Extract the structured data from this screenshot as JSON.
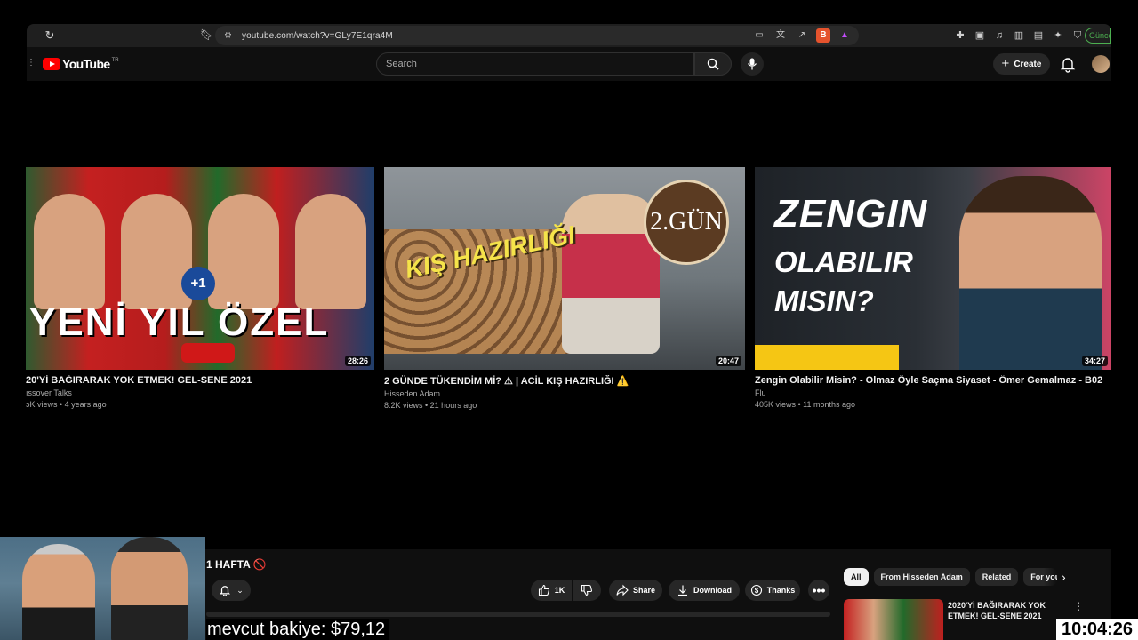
{
  "browser": {
    "url": "youtube.com/watch?v=GLy7E1qra4M",
    "update_label": "Güncelle"
  },
  "header": {
    "logo_text": "YouTube",
    "country_code": "TR",
    "search_placeholder": "Search",
    "create_label": "Create"
  },
  "end_screen": {
    "videos": [
      {
        "title": "20'Yİ BAĞIRARAK YOK ETMEK! GEL-SENE 2021",
        "channel": "ıssover Talks",
        "meta": "ɔK views • 4 years ago",
        "duration": "28:26",
        "thumb_text": "YENİ YIL ÖZEL",
        "thumb_badge": "+1"
      },
      {
        "title": "2 GÜNDE TÜKENDİM Mİ? ⚠ | ACİL KIŞ HAZIRLIĞI ⚠️",
        "channel": "Hisseden Adam",
        "meta": "8.2K views • 21 hours ago",
        "duration": "20:47",
        "thumb_text": "KIŞ HAZIRLIĞI",
        "thumb_badge": "2.GÜN"
      },
      {
        "title": "Zengin Olabilir Misin? - Olmaz Öyle Saçma Siyaset - Ömer Gemalmaz - B02",
        "channel": "Flu",
        "meta": "405K views • 11 months ago",
        "duration": "34:27",
        "thumb_line1": "ZENGIN",
        "thumb_line2": "OLABILIR",
        "thumb_line3": "MISIN?"
      }
    ]
  },
  "watch": {
    "title": "1 HAFTA 🚫",
    "like_count": "1K",
    "share_label": "Share",
    "download_label": "Download",
    "thanks_label": "Thanks",
    "more_label": "•••"
  },
  "sidebar": {
    "chips": [
      "All",
      "From Hisseden Adam",
      "Related",
      "For you"
    ],
    "related_title": "2020'Yİ BAĞIRARAK YOK ETMEK! GEL-SENE 2021"
  },
  "overlay": {
    "balance_text": "mevcut bakiye: $79,12",
    "clock": "10:04:26"
  },
  "colors": {
    "brand_red": "#ff0000",
    "background": "#0f0f0f",
    "chip_bg": "#272727"
  }
}
